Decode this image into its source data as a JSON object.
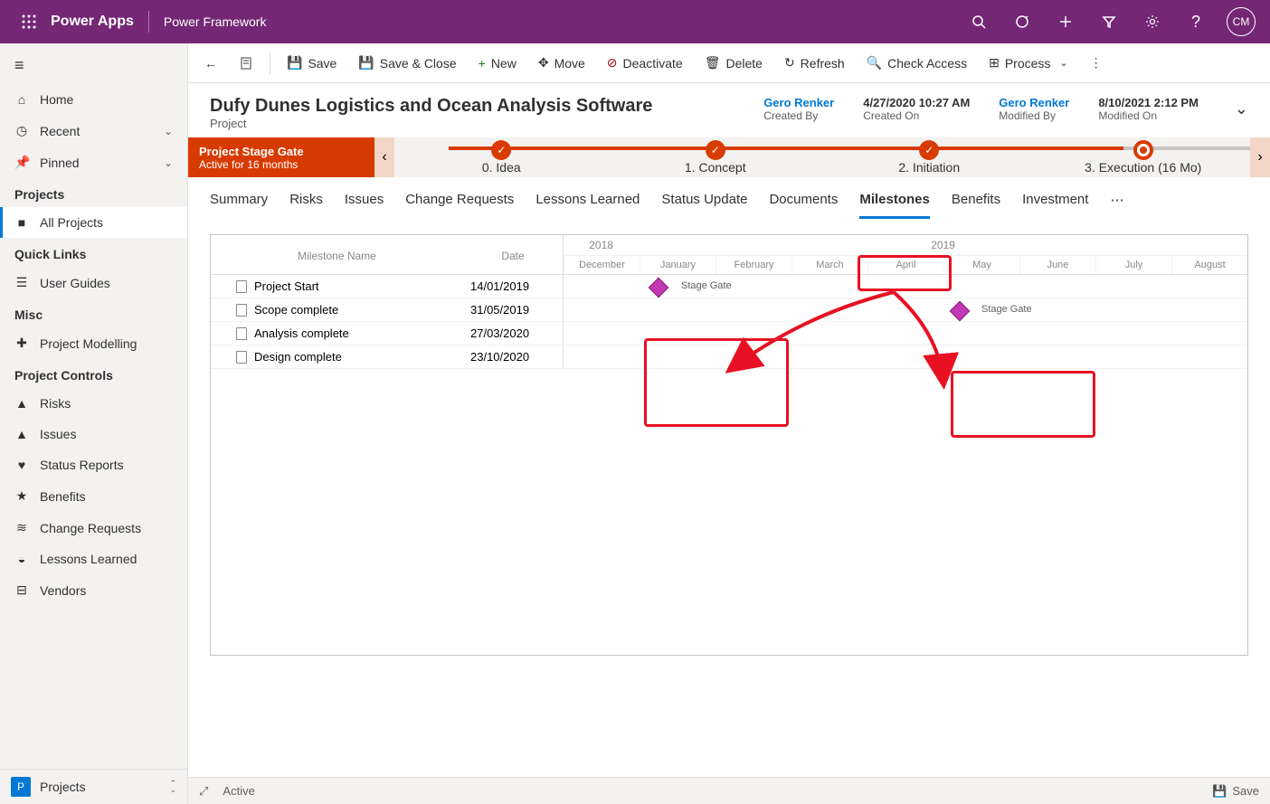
{
  "topbar": {
    "app": "Power Apps",
    "env": "Power Framework",
    "avatar": "CM"
  },
  "cmdbar": {
    "save": "Save",
    "saveclose": "Save & Close",
    "new": "New",
    "move": "Move",
    "deactivate": "Deactivate",
    "delete": "Delete",
    "refresh": "Refresh",
    "checkaccess": "Check Access",
    "process": "Process"
  },
  "sidebar": {
    "home": "Home",
    "recent": "Recent",
    "pinned": "Pinned",
    "g_projects": "Projects",
    "all_projects": "All Projects",
    "g_quicklinks": "Quick Links",
    "user_guides": "User Guides",
    "g_misc": "Misc",
    "project_modelling": "Project Modelling",
    "g_controls": "Project Controls",
    "risks": "Risks",
    "issues": "Issues",
    "status": "Status Reports",
    "benefits": "Benefits",
    "change": "Change Requests",
    "lessons": "Lessons Learned",
    "vendors": "Vendors",
    "footer_badge": "P",
    "footer_label": "Projects"
  },
  "record": {
    "title": "Dufy Dunes Logistics and Ocean Analysis Software",
    "subtype": "Project",
    "created_by": "Gero Renker",
    "created_by_l": "Created By",
    "created_on": "4/27/2020 10:27 AM",
    "created_on_l": "Created On",
    "modified_by": "Gero Renker",
    "modified_by_l": "Modified By",
    "modified_on": "8/10/2021 2:12 PM",
    "modified_on_l": "Modified On"
  },
  "bpf": {
    "name": "Project Stage Gate",
    "duration": "Active for 16 months",
    "stages": [
      "0. Idea",
      "1. Concept",
      "2. Initiation",
      "3. Execution  (16 Mo)"
    ]
  },
  "tabs": [
    "Summary",
    "Risks",
    "Issues",
    "Change Requests",
    "Lessons Learned",
    "Status Update",
    "Documents",
    "Milestones",
    "Benefits",
    "Investment"
  ],
  "active_tab": "Milestones",
  "gantt": {
    "col_name": "Milestone Name",
    "col_date": "Date",
    "years": [
      "2018",
      "2019"
    ],
    "months": [
      "December",
      "January",
      "February",
      "March",
      "April",
      "May",
      "June",
      "July",
      "August"
    ],
    "rows": [
      {
        "name": "Project Start",
        "date": "14/01/2019"
      },
      {
        "name": "Scope complete",
        "date": "31/05/2019"
      },
      {
        "name": "Analysis complete",
        "date": "27/03/2020"
      },
      {
        "name": "Design complete",
        "date": "23/10/2020"
      }
    ],
    "gate_label": "Stage Gate"
  },
  "footer": {
    "status": "Active",
    "save": "Save"
  }
}
